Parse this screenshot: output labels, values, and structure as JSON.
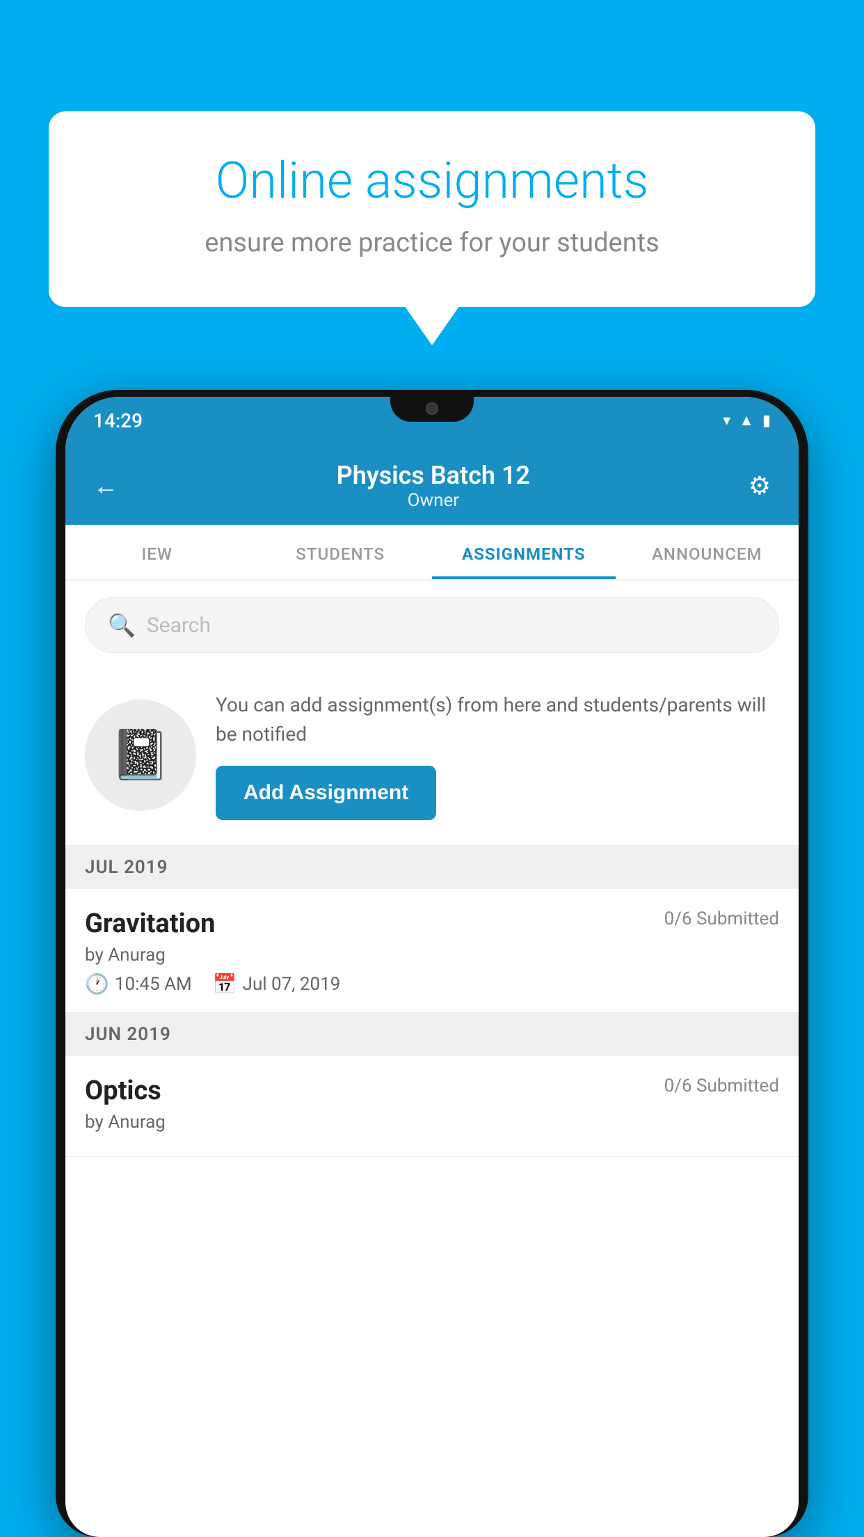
{
  "background_color": "#00AEEF",
  "speech_bubble": {
    "title": "Online assignments",
    "subtitle": "ensure more practice for your students"
  },
  "phone": {
    "status_bar": {
      "time": "14:29",
      "icons": [
        "wifi",
        "signal",
        "battery"
      ]
    },
    "header": {
      "title": "Physics Batch 12",
      "subtitle": "Owner",
      "back_label": "←",
      "settings_label": "⚙"
    },
    "tabs": [
      {
        "label": "IEW",
        "active": false
      },
      {
        "label": "STUDENTS",
        "active": false
      },
      {
        "label": "ASSIGNMENTS",
        "active": true
      },
      {
        "label": "ANNOUNCEM",
        "active": false
      }
    ],
    "search": {
      "placeholder": "Search"
    },
    "promo": {
      "text": "You can add assignment(s) from here and students/parents will be notified",
      "button_label": "Add Assignment"
    },
    "sections": [
      {
        "header": "JUL 2019",
        "assignments": [
          {
            "name": "Gravitation",
            "status": "0/6 Submitted",
            "by": "by Anurag",
            "time": "10:45 AM",
            "date": "Jul 07, 2019"
          }
        ]
      },
      {
        "header": "JUN 2019",
        "assignments": [
          {
            "name": "Optics",
            "status": "0/6 Submitted",
            "by": "by Anurag",
            "time": "",
            "date": ""
          }
        ]
      }
    ]
  }
}
